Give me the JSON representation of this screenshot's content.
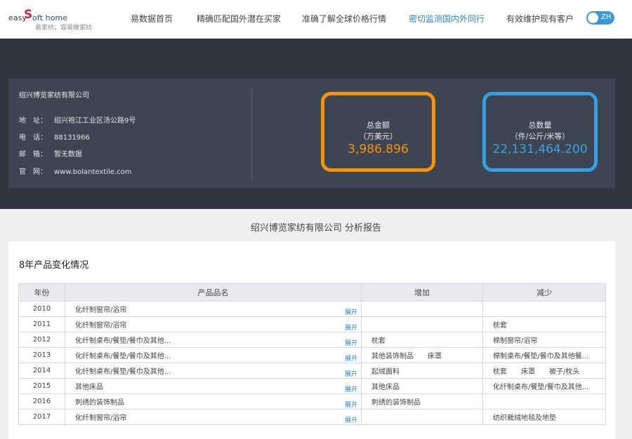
{
  "logo": {
    "easy": "easy",
    "s": "S",
    "rest": "oft home",
    "slogan": "易家纺，容易做家纺"
  },
  "nav": [
    "易数据首页",
    "精确匹配国外潜在买家",
    "准确了解全球价格行情",
    "密切监测国内外同行",
    "有效维护现有客户"
  ],
  "nav_active_index": 3,
  "lang_toggle": "ZH",
  "company": {
    "name": "绍兴博览家纺有限公司",
    "address_label": "地　址：",
    "address": "绍兴袍江工业区汤公路9号",
    "phone_label": "电　话：",
    "phone": "88131966",
    "email_label": "邮　箱：",
    "email": "暂无数据",
    "site_label": "官　网：",
    "site": "www.bolantextile.com"
  },
  "stats": {
    "amount_title": "总金额",
    "amount_unit": "（万美元）",
    "amount_value": "3,986.896",
    "qty_title": "总数量",
    "qty_unit": "（件/公斤/米等）",
    "qty_value": "22,131,464.200"
  },
  "report_title": "绍兴博览家纺有限公司 分析报告",
  "section_title": "8年产品变化情况",
  "table": {
    "headers": [
      "年份",
      "产品品名",
      "增加",
      "减少"
    ],
    "expand_label": "展开",
    "rows": [
      {
        "year": "2010",
        "product": "化纤制窗帘/浴帘",
        "add": "",
        "remove": ""
      },
      {
        "year": "2011",
        "product": "化纤制窗帘/浴帘",
        "add": "",
        "remove": "枕套"
      },
      {
        "year": "2012",
        "product": "化纤制桌布/餐垫/餐巾及其他...",
        "add": "枕套",
        "remove": "棉制窗帘/浴帘"
      },
      {
        "year": "2013",
        "product": "化纤制桌布/餐垫/餐巾及其他...",
        "add": "其他装饰制品　　床罩",
        "remove": "棉制桌布/餐垫/餐巾及其他餐..."
      },
      {
        "year": "2014",
        "product": "化纤制桌布/餐垫/餐巾及其他...",
        "add": "起绒面料",
        "remove": "枕套　　床罩　　被子/枕头"
      },
      {
        "year": "2015",
        "product": "其他床品",
        "add": "其他床品",
        "remove": "化纤制桌布/餐垫/餐巾及其他..."
      },
      {
        "year": "2016",
        "product": "刺绣的装饰制品",
        "add": "刺绣的装饰制品",
        "remove": ""
      },
      {
        "year": "2017",
        "product": "化纤制窗帘/浴帘",
        "add": "",
        "remove": "纺织栽绒地毯及地垫"
      }
    ]
  },
  "colors": {
    "accent_blue": "#2a86c9",
    "orange": "#f5930f",
    "blue": "#3a9fe0",
    "dark_bg": "#2e3440"
  }
}
